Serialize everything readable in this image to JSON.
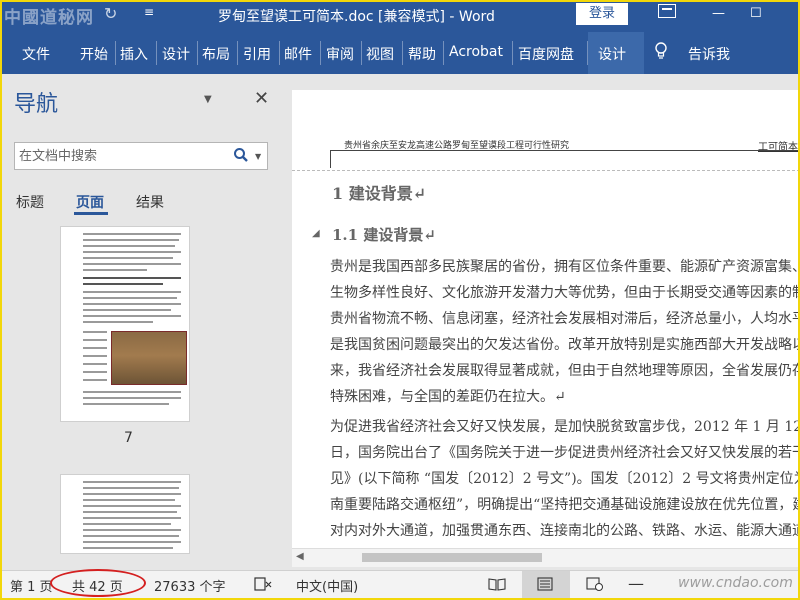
{
  "titlebar": {
    "watermark": "中國道秘网",
    "title": "罗甸至望谟工可简本.doc [兼容模式] - Word",
    "login_label": "登录"
  },
  "ribbon": {
    "tabs": [
      "文件",
      "开始",
      "插入",
      "设计",
      "布局",
      "引用",
      "邮件",
      "审阅",
      "视图",
      "帮助",
      "Acrobat",
      "百度网盘",
      "设计"
    ],
    "tell_me": "告诉我"
  },
  "nav": {
    "title": "导航",
    "search_placeholder": "在文档中搜索",
    "tabs": [
      "标题",
      "页面",
      "结果"
    ],
    "active_tab": "页面",
    "page_number": "7"
  },
  "document": {
    "header_left": "贵州省余庆至安龙高速公路罗甸至望谟段工程可行性研究",
    "header_right": "工可简本",
    "heading1": "1  建设背景↵",
    "heading2": "1.1  建设背景↵",
    "paragraph_lines": [
      "    贵州是我国西部多民族聚居的省份，拥有区位条件重要、能源矿产资源富集、",
      "生物多样性良好、文化旅游开发潜力大等优势，但由于长期受交通等因素的制约，",
      "贵州省物流不畅、信息闭塞，经济社会发展相对滞后，经济总量小，人均水平低，",
      "是我国贫困问题最突出的欠发达省份。改革开放特别是实施西部大开发战略以",
      "来，我省经济社会发展取得显著成就，但由于自然地理等原因，全省发展仍存在",
      "特殊困难，与全国的差距仍在拉大。↵",
      "    为促进我省经济社会又好又快发展，是加快脱贫致富步伐，2012 年 1 月 12",
      "日，国务院出台了《国务院关于进一步促进贵州经济社会又好又快发展的若干意",
      "见》(以下简称 “国发〔2012〕2 号文”)。国发〔2012〕2 号文将贵州定位为“西",
      "南重要陆路交通枢纽”，明确提出“坚持把交通基础设施建设放在优先位置，建设",
      "对内对外大通道，加强贯通东西、连接南北的公路、铁路、水运、能源大通道建"
    ]
  },
  "statusbar": {
    "page": "第 1 页",
    "total_pages": "共 42 页",
    "word_count": "27633 个字",
    "language": "中文(中国)",
    "watermark": "www.cndao.com"
  },
  "colors": {
    "word_blue": "#2b579a",
    "highlight_red": "#d42020",
    "frame_yellow": "#f2d70a"
  }
}
